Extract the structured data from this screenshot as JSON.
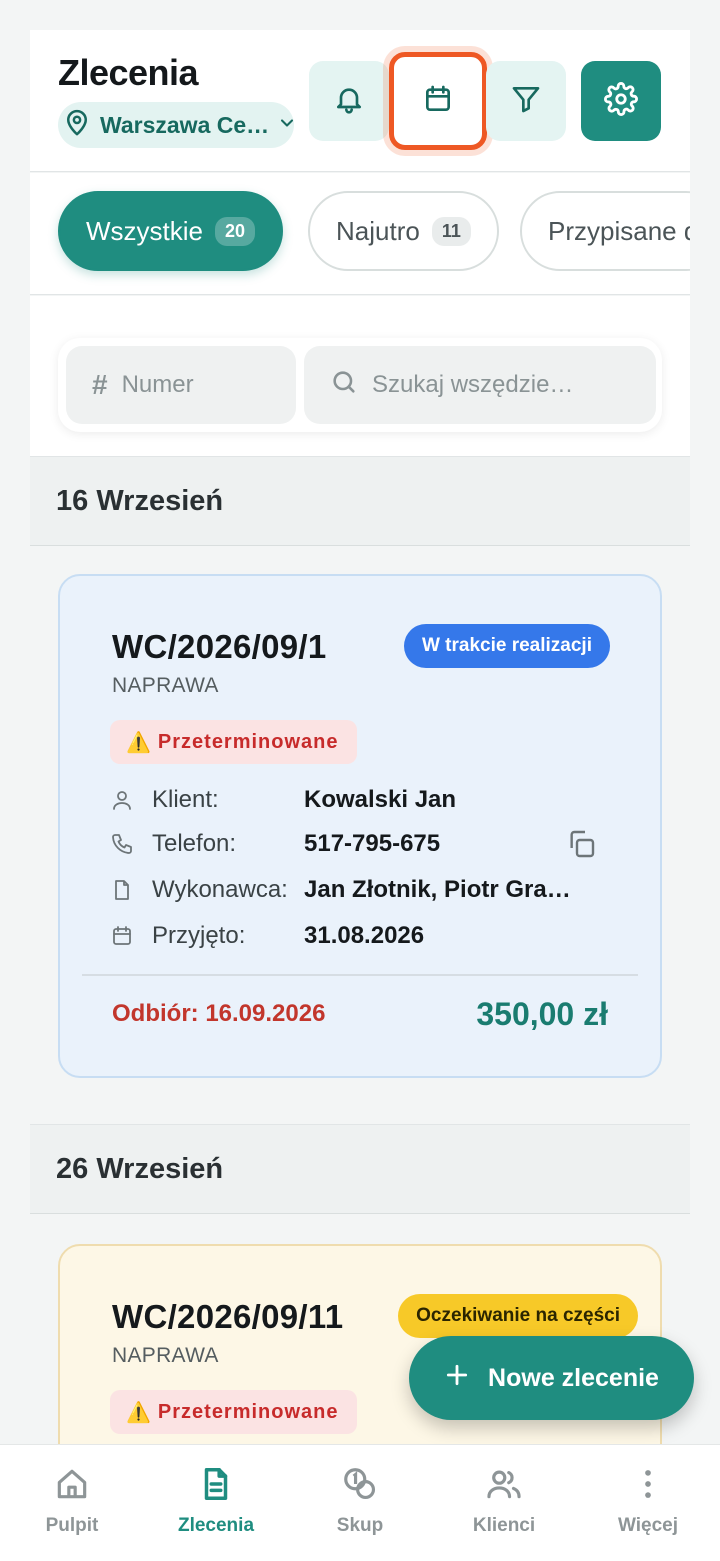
{
  "header": {
    "title": "Zlecenia",
    "location": "Warszawa Ce…",
    "buttons": {
      "notifications": "bell-icon",
      "calendar": "calendar-icon",
      "filter": "filter-icon",
      "settings": "gear-icon"
    }
  },
  "tabs": [
    {
      "label": "Wszystkie",
      "count": "20"
    },
    {
      "label": "Najutro",
      "count": "11"
    },
    {
      "label": "Przypisane d"
    }
  ],
  "search": {
    "number_placeholder": "Numer",
    "global_placeholder": "Szukaj wszędzie…"
  },
  "sections": [
    {
      "date": "16 Wrzesień",
      "order": {
        "number": "WC/2026/09/1",
        "type": "NAPRAWA",
        "status": "W trakcie realizacji",
        "overdue": "Przeterminowane",
        "client_label": "Klient:",
        "client": "Kowalski Jan",
        "phone_label": "Telefon:",
        "phone": "517-795-675",
        "executor_label": "Wykonawca:",
        "executor": "Jan Złotnik, Piotr Gra…",
        "accepted_label": "Przyjęto:",
        "accepted": "31.08.2026",
        "pickup": "Odbiór: 16.09.2026",
        "price": "350,00 zł"
      }
    },
    {
      "date": "26 Wrzesień",
      "order": {
        "number": "WC/2026/09/11",
        "type": "NAPRAWA",
        "status": "Oczekiwanie na części",
        "overdue": "Przeterminowane"
      }
    }
  ],
  "fab": {
    "label": "Nowe zlecenie"
  },
  "bottom_nav": [
    {
      "label": "Pulpit",
      "icon": "home-icon"
    },
    {
      "label": "Zlecenia",
      "icon": "document-icon",
      "active": true
    },
    {
      "label": "Skup",
      "icon": "coins-icon"
    },
    {
      "label": "Klienci",
      "icon": "users-icon"
    },
    {
      "label": "Więcej",
      "icon": "more-vertical-icon"
    }
  ],
  "colors": {
    "accent": "#1f8d80",
    "status_in_progress": "#3578ea",
    "status_waiting_parts": "#f7c928",
    "overdue": "#c72b2b",
    "focus_ring": "#ee5824"
  }
}
